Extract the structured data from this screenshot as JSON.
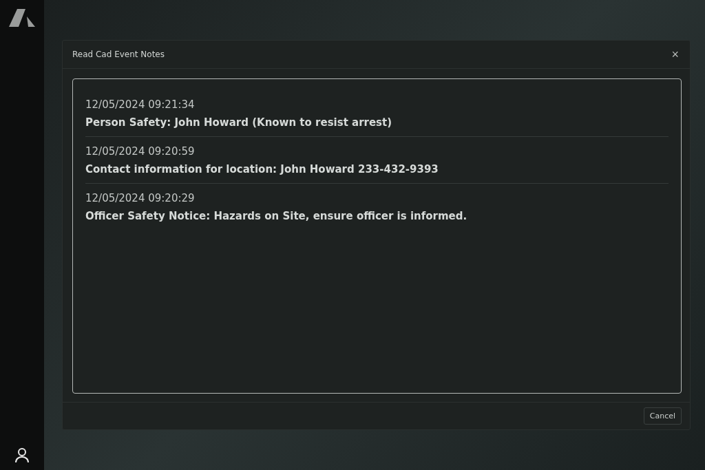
{
  "dialog": {
    "title": "Read Cad Event Notes",
    "close": "×",
    "notes": [
      {
        "timestamp": "12/05/2024 09:21:34",
        "text": "Person Safety: John Howard (Known to resist arrest)"
      },
      {
        "timestamp": "12/05/2024 09:20:59",
        "text": "Contact information for location: John Howard 233-432-9393"
      },
      {
        "timestamp": "12/05/2024 09:20:29",
        "text": "Officer Safety Notice: Hazards on Site, ensure officer is informed."
      }
    ],
    "buttons": [
      "Cancel"
    ]
  }
}
